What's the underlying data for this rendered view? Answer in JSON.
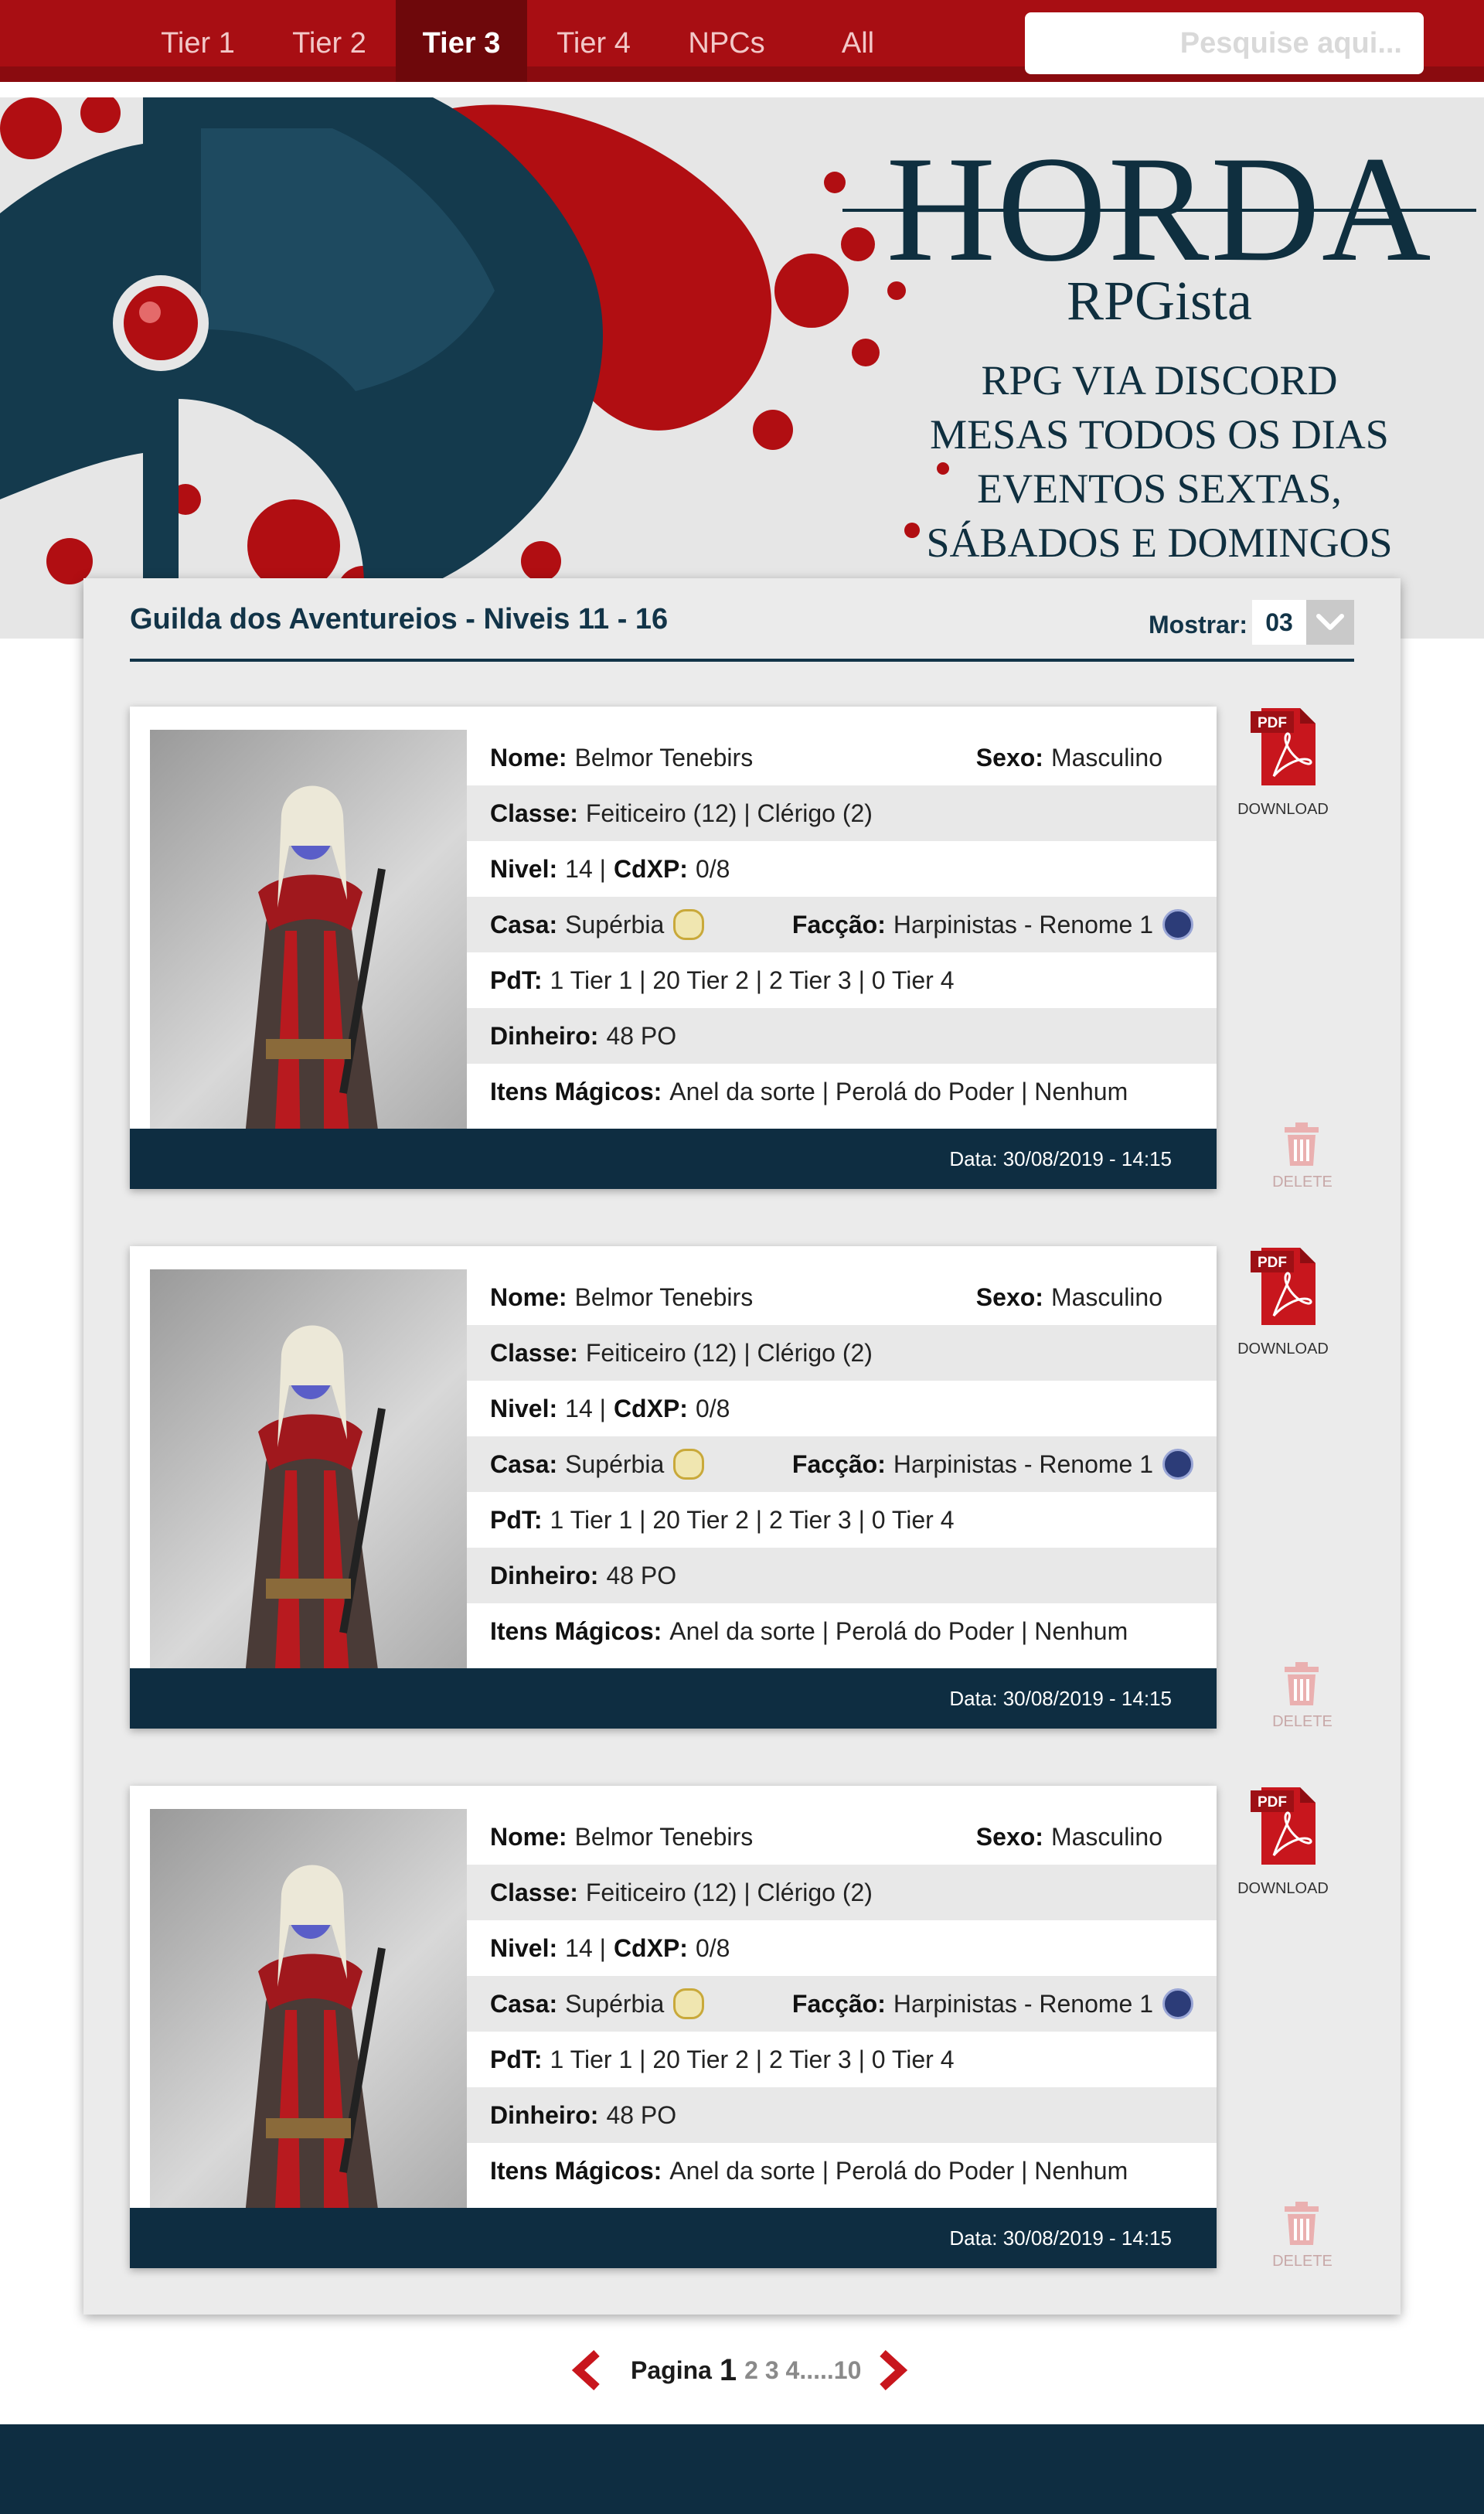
{
  "nav": {
    "tabs": [
      {
        "label": "Tier 1"
      },
      {
        "label": "Tier 2"
      },
      {
        "label": "Tier 3",
        "active": true
      },
      {
        "label": "Tier 4"
      },
      {
        "label": "NPCs"
      },
      {
        "label": "All"
      }
    ],
    "search_placeholder": "Pesquise aqui..."
  },
  "banner": {
    "title": "HORDA",
    "subtitle": "RPGista",
    "lines": [
      "RPG VIA DISCORD",
      "MESAS TODOS OS DIAS",
      "EVENTOS SEXTAS,",
      "SÁBADOS E DOMINGOS"
    ]
  },
  "panel": {
    "title": "Guilda dos Aventureios - Niveis 11 - 16",
    "show_label": "Mostrar:",
    "show_value": "03"
  },
  "labels": {
    "nome": "Nome:",
    "sexo": "Sexo:",
    "classe": "Classe:",
    "nivel": "Nivel:",
    "cdxp": "CdXP:",
    "casa": "Casa:",
    "faccao": "Facção:",
    "pdt": "PdT:",
    "dinheiro": "Dinheiro:",
    "itens": "Itens Mágicos:",
    "download": "DOWNLOAD",
    "delete": "DELETE",
    "pdf": "PDF"
  },
  "characters": [
    {
      "nome": "Belmor Tenebirs",
      "sexo": "Masculino",
      "classe": "Feiticeiro (12) | Clérigo (2)",
      "nivel": "14 |",
      "cdxp": "0/8",
      "casa": "Supérbia",
      "faccao": "Harpinistas - Renome 1",
      "pdt": "1 Tier 1 | 20 Tier 2 | 2 Tier 3 | 0 Tier 4",
      "dinheiro": "48 PO",
      "itens": "Anel da sorte | Perolá do Poder | Nenhum",
      "data": "Data: 30/08/2019 - 14:15"
    },
    {
      "nome": "Belmor Tenebirs",
      "sexo": "Masculino",
      "classe": "Feiticeiro (12) | Clérigo (2)",
      "nivel": "14 |",
      "cdxp": "0/8",
      "casa": "Supérbia",
      "faccao": "Harpinistas - Renome 1",
      "pdt": "1 Tier 1 | 20 Tier 2 | 2 Tier 3 | 0 Tier 4",
      "dinheiro": "48 PO",
      "itens": "Anel da sorte | Perolá do Poder | Nenhum",
      "data": "Data: 30/08/2019 - 14:15"
    },
    {
      "nome": "Belmor Tenebirs",
      "sexo": "Masculino",
      "classe": "Feiticeiro (12) | Clérigo (2)",
      "nivel": "14 |",
      "cdxp": "0/8",
      "casa": "Supérbia",
      "faccao": "Harpinistas - Renome 1",
      "pdt": "1 Tier 1 | 20 Tier 2 | 2 Tier 3 | 0 Tier 4",
      "dinheiro": "48 PO",
      "itens": "Anel da sorte | Perolá do Poder | Nenhum",
      "data": "Data: 30/08/2019 - 14:15"
    }
  ],
  "pagination": {
    "label": "Pagina",
    "current": "1",
    "rest": "2 3 4.....10"
  },
  "colors": {
    "nav_red": "#a80e13",
    "navy": "#0e2d41",
    "pdf_red": "#c8161d"
  }
}
